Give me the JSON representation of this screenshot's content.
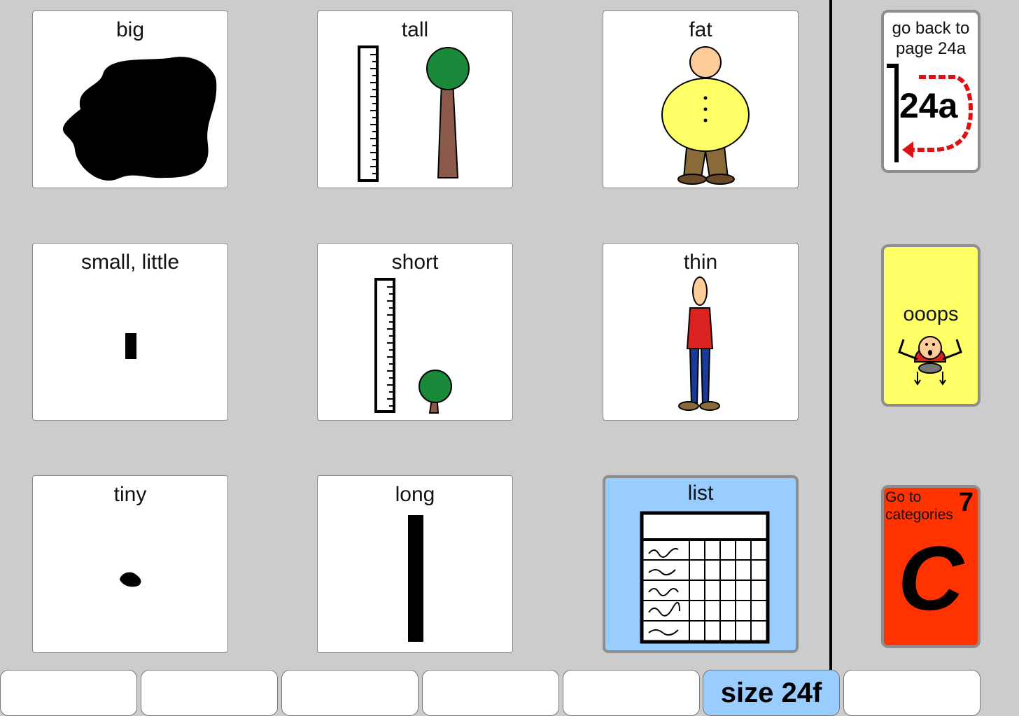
{
  "grid": {
    "big": "big",
    "tall": "tall",
    "fat": "fat",
    "small": "small, little",
    "short": "short",
    "thin": "thin",
    "tiny": "tiny",
    "long": "long",
    "list": "list"
  },
  "sidebar": {
    "back_label": "go back to page 24a",
    "back_page": "24a",
    "oops_label": "ooops",
    "categories_label": "Go to categories",
    "categories_number": "7",
    "categories_letter": "C"
  },
  "bottom_bar": {
    "slots": [
      "",
      "",
      "",
      "",
      "",
      "size 24f",
      ""
    ]
  },
  "colors": {
    "background": "#cccccc",
    "cell": "#ffffff",
    "list_cell": "#99ccff",
    "oops": "#ffff66",
    "categories": "#ff3300",
    "active_button": "#99ccff"
  }
}
